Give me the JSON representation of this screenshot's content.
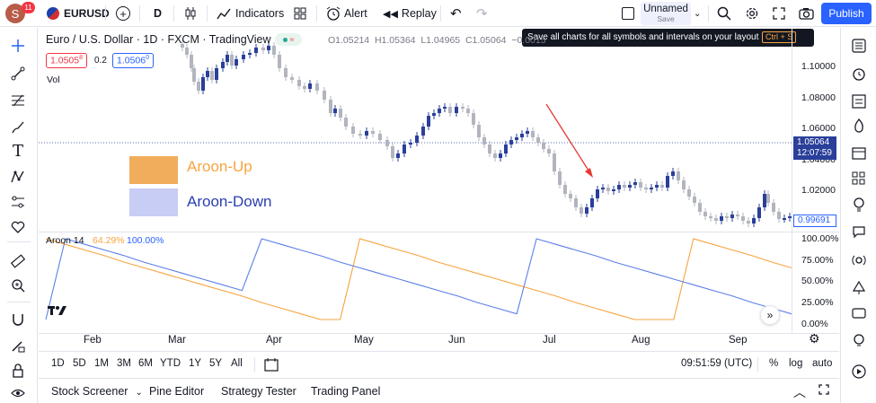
{
  "topbar": {
    "avatar_letter": "S",
    "notif_count": "11",
    "symbol": "EURUSD",
    "interval": "D",
    "indicators_label": "Indicators",
    "alert_label": "Alert",
    "replay_label": "Replay",
    "layout_name": "Unnamed",
    "layout_save": "Save",
    "publish_label": "Publish"
  },
  "tooltip": {
    "text": "Save all charts for all symbols and intervals on your layout",
    "shortcut": "Ctrl + S"
  },
  "chart": {
    "title": "Euro / U.S. Dollar · 1D · FXCM · TradingView",
    "ohlc": "O1.05214  H1.05364  L1.04965  C1.05064  −0.0015",
    "sell_price": "1.0505",
    "sell_sup": "8",
    "spread": "0.2",
    "buy_price": "1.0506",
    "buy_sup": "0",
    "vol_label": "Vol",
    "price_ticks": [
      "1.10000",
      "1.08000",
      "1.06000",
      "1.04000",
      "1.02000"
    ],
    "last_price": "1.05064",
    "countdown": "12:07:59",
    "low_marker": "0.99691",
    "aroon_up_legend": "Aroon-Up",
    "aroon_down_legend": "Aroon-Down",
    "aroon_label": "Aroon 14",
    "aroon_up_val": "64.29%",
    "aroon_down_val": "100.00%",
    "aroon_ticks": [
      "100.00%",
      "75.00%",
      "50.00%",
      "25.00%",
      "0.00%"
    ],
    "months": [
      "Feb",
      "Mar",
      "Apr",
      "May",
      "Jun",
      "Jul",
      "Aug",
      "Sep"
    ],
    "colors": {
      "up": "#2a3f9a",
      "down": "#b2b5be",
      "aroon_up": "#f7a440",
      "aroon_down": "#5b7fe8",
      "arrow": "#e53935",
      "blue_accent": "#2962ff"
    }
  },
  "range_bar": {
    "ranges": [
      "1D",
      "5D",
      "1M",
      "3M",
      "6M",
      "YTD",
      "1Y",
      "5Y",
      "All"
    ],
    "time": "09:51:59 (UTC)",
    "pct": "%",
    "log": "log",
    "auto": "auto"
  },
  "bottom_panel": {
    "stock_screener": "Stock Screener",
    "pine_editor": "Pine Editor",
    "strategy_tester": "Strategy Tester",
    "trading_panel": "Trading Panel"
  },
  "chart_data": {
    "type": "line",
    "series": [
      {
        "name": "Aroon-Up",
        "values": [
          100,
          93,
          86,
          79,
          71,
          64,
          57,
          50,
          43,
          36,
          29,
          21,
          14,
          7,
          0,
          0,
          100,
          93,
          86,
          79,
          71,
          64,
          57,
          50,
          43,
          36,
          29,
          21,
          14,
          7,
          0,
          0,
          0,
          100,
          93,
          86,
          79,
          71,
          64
        ]
      },
      {
        "name": "Aroon-Down",
        "values": [
          0,
          100,
          93,
          86,
          79,
          71,
          64,
          57,
          50,
          43,
          36,
          100,
          93,
          86,
          79,
          71,
          64,
          57,
          50,
          43,
          36,
          29,
          21,
          14,
          7,
          100,
          93,
          86,
          79,
          71,
          64,
          57,
          50,
          43,
          36,
          29,
          21,
          14,
          7
        ]
      }
    ]
  }
}
